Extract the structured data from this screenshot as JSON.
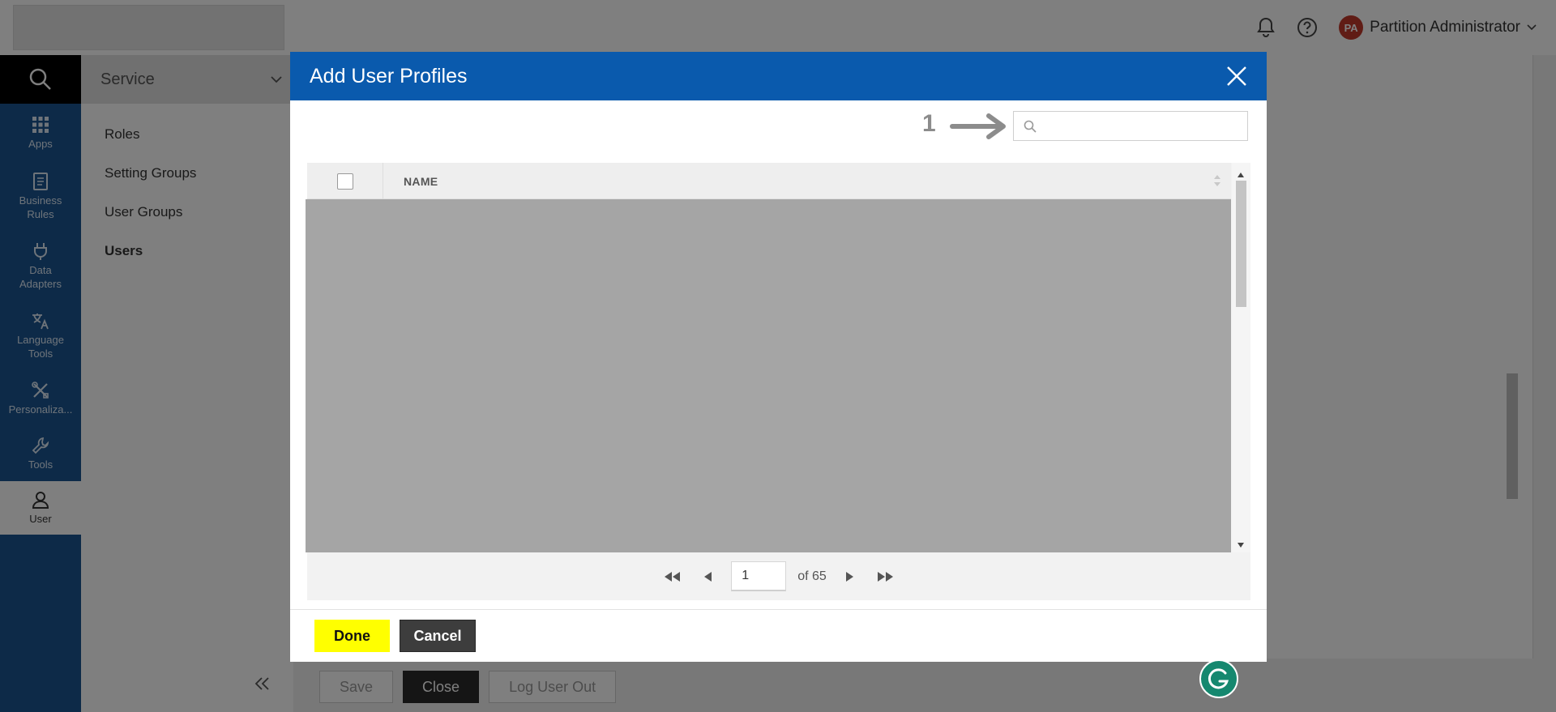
{
  "topbar": {
    "user_initials": "PA",
    "user_name": "Partition Administrator",
    "icons": [
      "bell-icon",
      "help-icon",
      "chevron-down-icon"
    ]
  },
  "leftnav": {
    "items": [
      {
        "label": "Apps",
        "icon": "apps-grid-icon"
      },
      {
        "label": "Business Rules",
        "icon": "document-icon"
      },
      {
        "label": "Data Adapters",
        "icon": "plug-icon"
      },
      {
        "label": "Language Tools",
        "icon": "translate-icon"
      },
      {
        "label": "Personaliza...",
        "icon": "tools-cross-icon"
      },
      {
        "label": "Tools",
        "icon": "wrench-icon"
      },
      {
        "label": "User",
        "icon": "user-icon"
      }
    ]
  },
  "subnav": {
    "title": "Service",
    "links": [
      "Roles",
      "Setting Groups",
      "User Groups",
      "Users"
    ],
    "active": "Users"
  },
  "page_footer": {
    "save_label": "Save",
    "close_label": "Close",
    "logout_label": "Log User Out"
  },
  "modal": {
    "title": "Add User Profiles",
    "annotation_step": "1",
    "search": {
      "value": "",
      "placeholder": ""
    },
    "grid": {
      "columns": [
        "NAME"
      ],
      "rows": []
    },
    "pager": {
      "current_page": "1",
      "of_text": "of 65"
    },
    "done_label": "Done",
    "cancel_label": "Cancel"
  },
  "colors": {
    "header_blue": "#0a5aad",
    "nav_blue": "#1a5590",
    "done_yellow": "#ffff00",
    "avatar_red": "#c0392b"
  }
}
